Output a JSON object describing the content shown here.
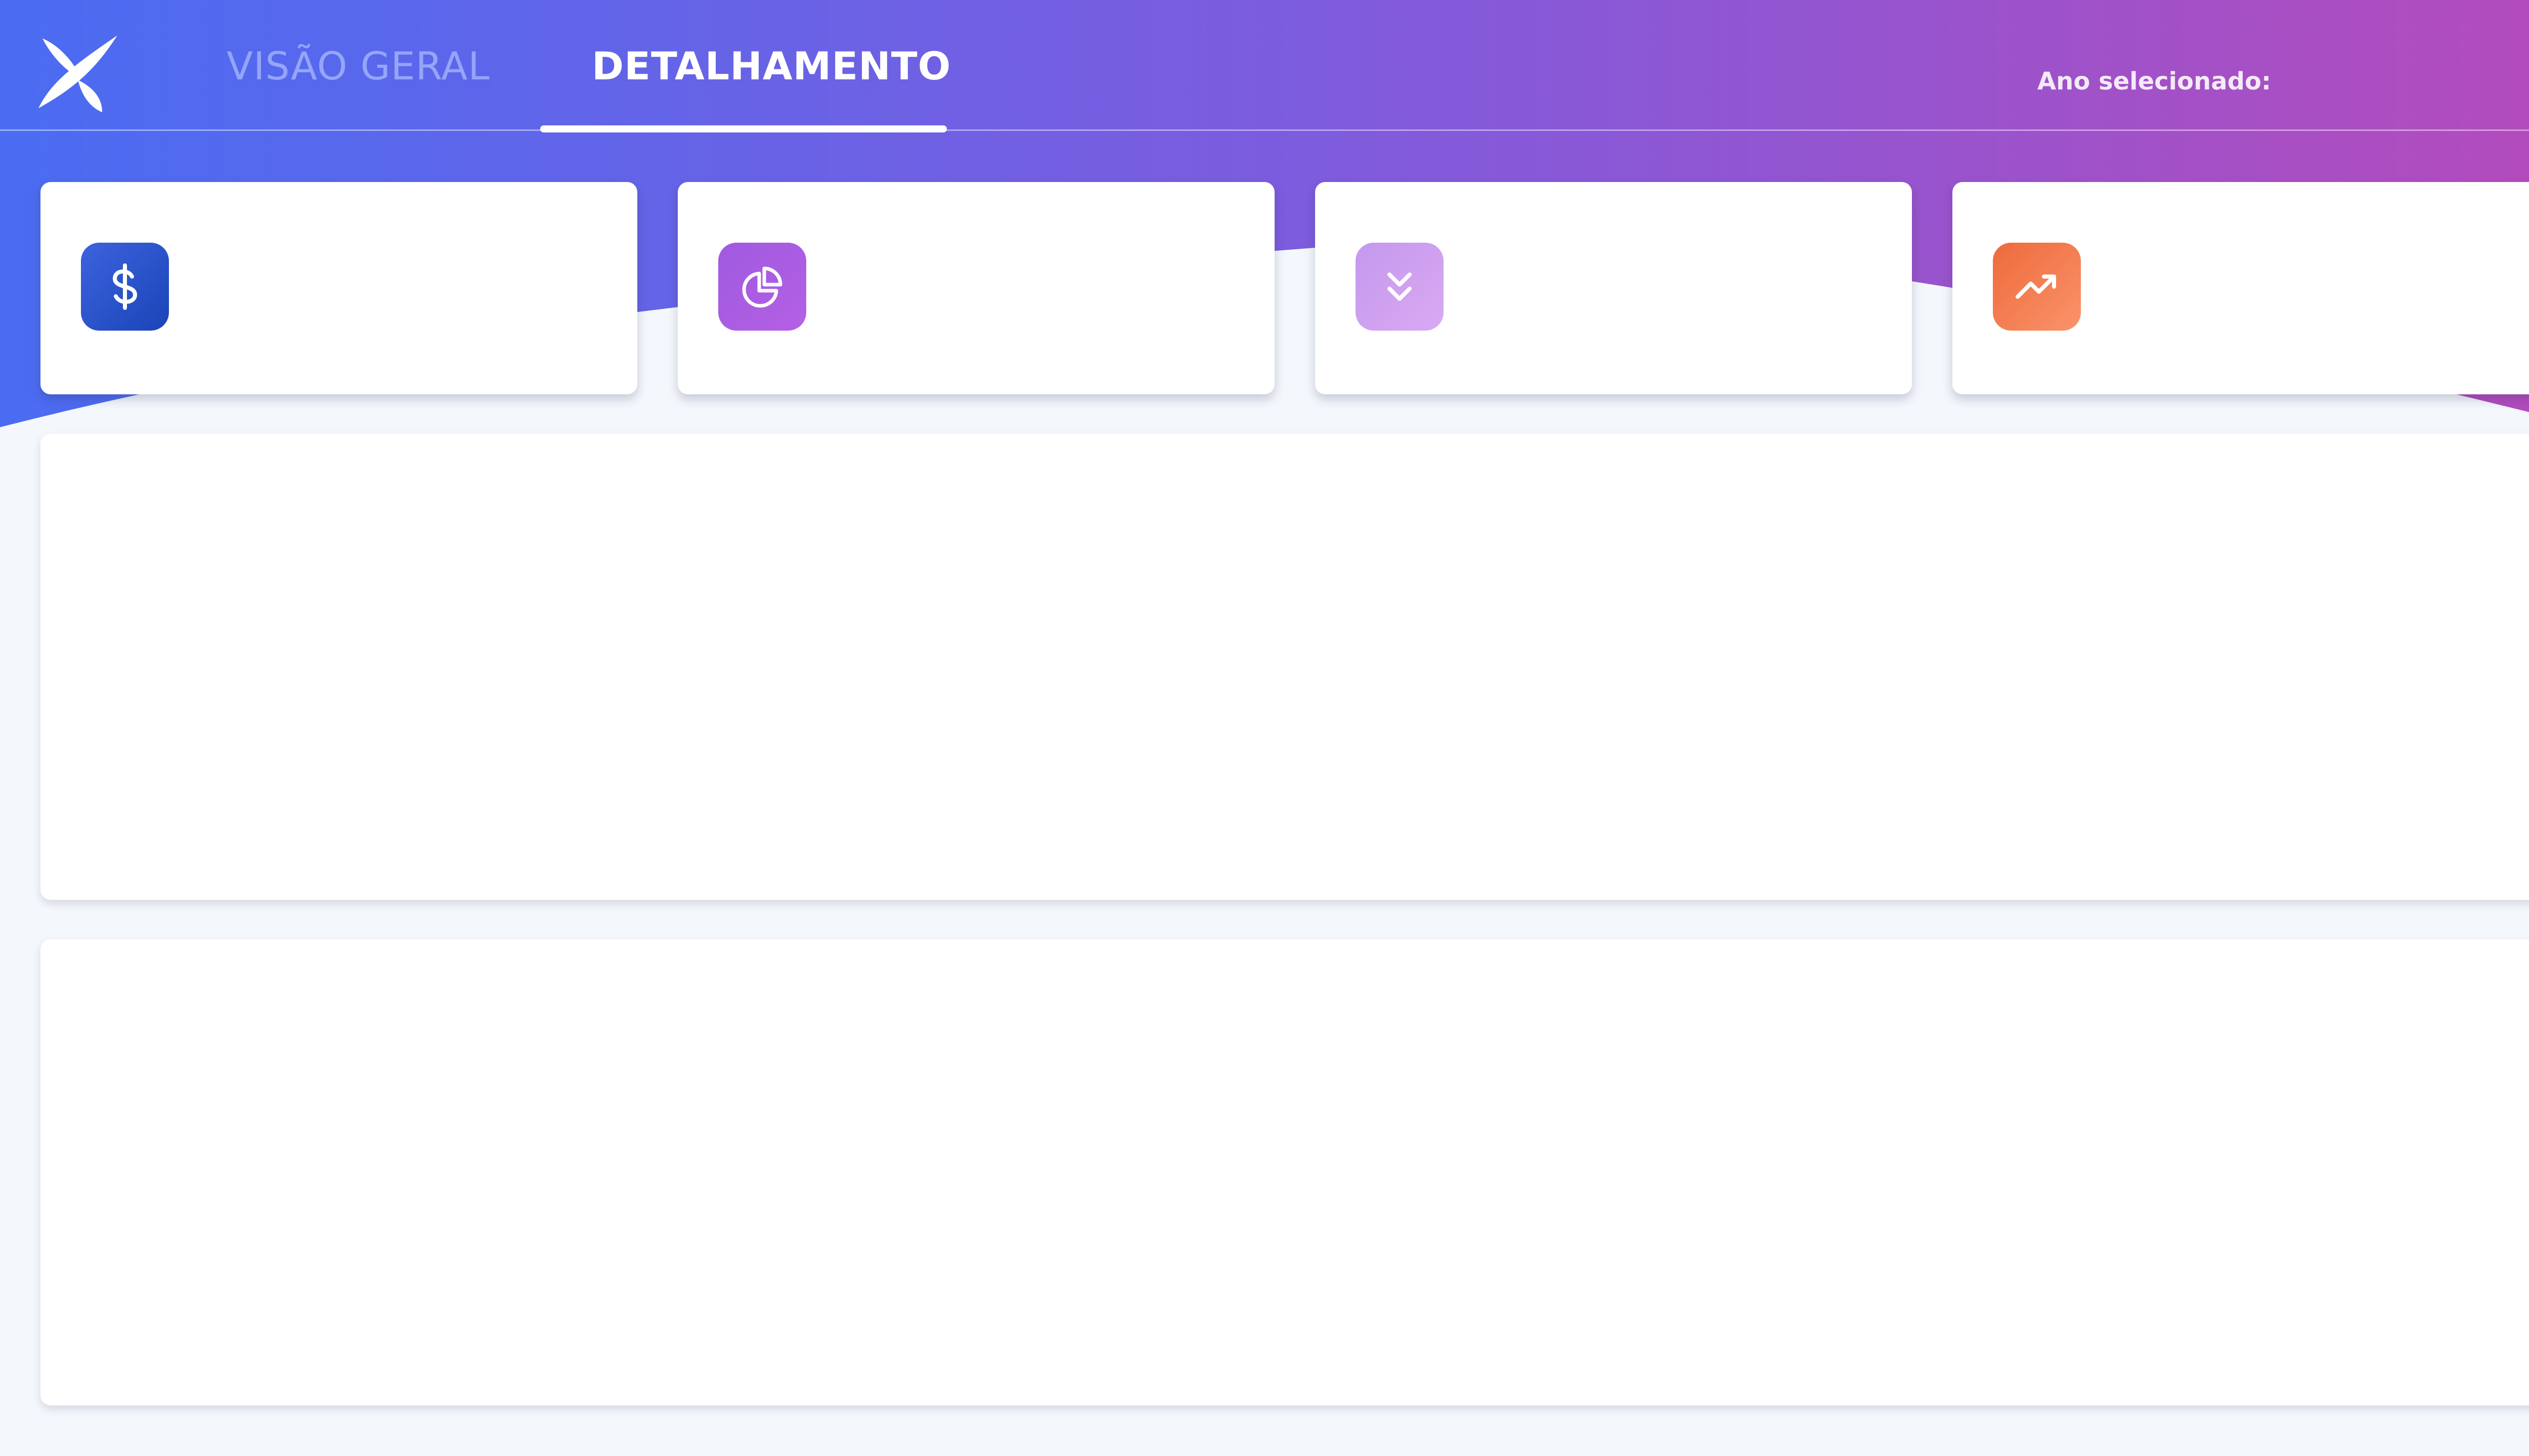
{
  "header": {
    "tabs": [
      {
        "label": "VISÃO GERAL",
        "active": false
      },
      {
        "label": "DETALHAMENTO",
        "active": true
      }
    ],
    "year_label": "Ano selecionado:",
    "gradient_colors": [
      "#4a6cf2",
      "#7d5cde",
      "#b54bbc"
    ]
  },
  "kpi_cards": [
    {
      "icon": "dollar-icon",
      "color": "#2752c8"
    },
    {
      "icon": "pie-chart-icon",
      "color": "#a85ce2"
    },
    {
      "icon": "chevrons-down-icon",
      "color": "#d1a3f0"
    },
    {
      "icon": "trending-up-icon",
      "color": "#f27a4d"
    }
  ],
  "panels": [
    {
      "name": "top-panel"
    },
    {
      "name": "bottom-panel"
    }
  ]
}
